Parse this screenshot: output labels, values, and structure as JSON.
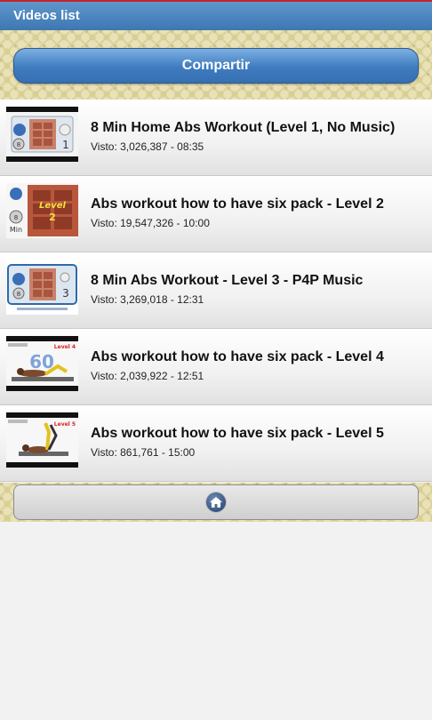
{
  "header": {
    "title": "Videos list"
  },
  "toolbar": {
    "share_label": "Compartir"
  },
  "videos": [
    {
      "title": "8 Min Home Abs Workout (Level 1, No Music)",
      "meta": "Visto: 3,026,387 - 08:35",
      "thumb_icon": "abs-level-1-thumbnail"
    },
    {
      "title": "Abs workout how to have six pack - Level 2",
      "meta": "Visto: 19,547,326 - 10:00",
      "thumb_icon": "abs-level-2-thumbnail"
    },
    {
      "title": "8 Min Abs Workout - Level 3 - P4P Music",
      "meta": "Visto: 3,269,018 - 12:31",
      "thumb_icon": "abs-level-3-thumbnail"
    },
    {
      "title": "Abs workout how to have six pack - Level 4",
      "meta": "Visto: 2,039,922 - 12:51",
      "thumb_icon": "abs-level-4-thumbnail"
    },
    {
      "title": "Abs workout how to have six pack - Level 5",
      "meta": "Visto: 861,761 - 15:00",
      "thumb_icon": "abs-level-5-thumbnail"
    }
  ],
  "thumb_text": {
    "t1_left_num": "8",
    "t1_right_num": "1",
    "t2_level": "Level",
    "t2_level_num": "2",
    "t2_left_num": "8",
    "t2_left_unit": "Min",
    "t3_left_num": "8",
    "t3_right_num": "3",
    "t4_number": "60",
    "t4_level": "Level 4",
    "t5_level": "Level 5"
  },
  "footer": {
    "home_icon": "home-icon"
  },
  "colors": {
    "topbar": "#4a84bf",
    "accent_red": "#c8232c",
    "share_button": "#3e7bbf"
  }
}
